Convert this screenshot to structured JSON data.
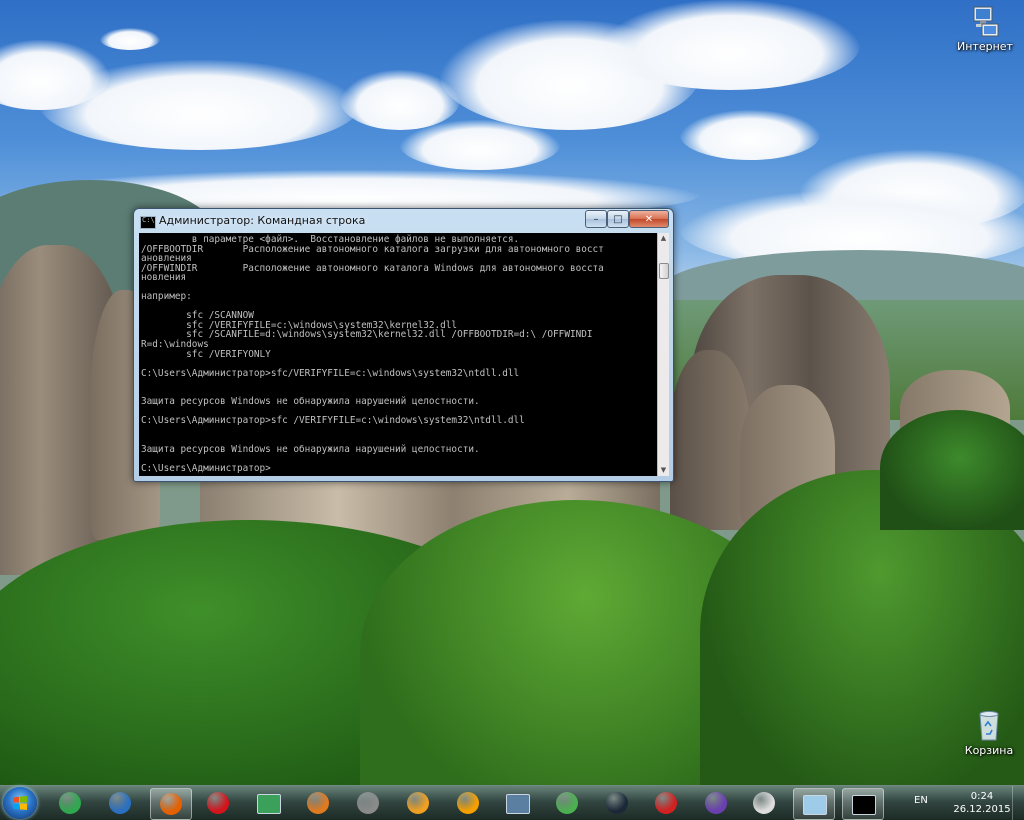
{
  "desktop": {
    "icons": [
      {
        "label": "Интернет",
        "icon": "network-computer-icon"
      },
      {
        "label": "Корзина",
        "icon": "recycle-bin-icon"
      }
    ]
  },
  "window": {
    "title": "Администратор: Командная строка",
    "icon_text": "C:\\",
    "buttons": {
      "minimize": "–",
      "maximize": "□",
      "close": "✕"
    },
    "console_lines": [
      "         в параметре <файл>.  Восстановление файлов не выполняется.",
      "/OFFBOOTDIR       Расположение автономного каталога загрузки для автономного восст",
      "ановления",
      "/OFFWINDIR        Расположение автономного каталога Windows для автономного восста",
      "новления",
      "",
      "например:",
      "",
      "        sfc /SCANNOW",
      "        sfc /VERIFYFILE=c:\\windows\\system32\\kernel32.dll",
      "        sfc /SCANFILE=d:\\windows\\system32\\kernel32.dll /OFFBOOTDIR=d:\\ /OFFWINDI",
      "R=d:\\windows",
      "        sfc /VERIFYONLY",
      "",
      "C:\\Users\\Администратор>sfc/VERIFYFILE=c:\\windows\\system32\\ntdll.dll",
      "",
      "",
      "Защита ресурсов Windows не обнаружила нарушений целостности.",
      "",
      "C:\\Users\\Администратор>sfc /VERIFYFILE=c:\\windows\\system32\\ntdll.dll",
      "",
      "",
      "Защита ресурсов Windows не обнаружила нарушений целостности.",
      "",
      "C:\\Users\\Администратор>"
    ]
  },
  "taskbar": {
    "apps": [
      {
        "name": "mail-ru-agent",
        "icon": "mail-at-icon",
        "color": "#2fa84f"
      },
      {
        "name": "browser-w",
        "icon": "w-browser-icon",
        "color": "#2a6fc0"
      },
      {
        "name": "firefox",
        "icon": "firefox-icon",
        "color": "#e66000",
        "active": true
      },
      {
        "name": "opera",
        "icon": "opera-icon",
        "color": "#d4141c"
      },
      {
        "name": "screen-app",
        "icon": "monitor-frame-icon",
        "color": "#3aa05a"
      },
      {
        "name": "eye-app",
        "icon": "eye-icon",
        "color": "#e07a20"
      },
      {
        "name": "disk-tool",
        "icon": "disk-tool-icon",
        "color": "#8a8a8a"
      },
      {
        "name": "swirl-app",
        "icon": "swirl-icon",
        "color": "#f0a020"
      },
      {
        "name": "aimp",
        "icon": "aimp-triangle-icon",
        "color": "#f5a000"
      },
      {
        "name": "monitor-app",
        "icon": "monitor-icon",
        "color": "#5a7fa0"
      },
      {
        "name": "mp3-app",
        "icon": "mp3-icon",
        "color": "#4caf50"
      },
      {
        "name": "steam",
        "icon": "steam-icon",
        "color": "#1b2838"
      },
      {
        "name": "apple-app",
        "icon": "apple-icon",
        "color": "#d32020"
      },
      {
        "name": "writer-app",
        "icon": "pen-book-icon",
        "color": "#6a3fb0"
      },
      {
        "name": "chess-app",
        "icon": "chess-piece-icon",
        "color": "#dddddd"
      },
      {
        "name": "explorer-window",
        "icon": "window-icon",
        "color": "#9ecbe8",
        "active": true
      },
      {
        "name": "cmd-window",
        "icon": "cmd-icon",
        "color": "#000000",
        "active": true
      }
    ],
    "language": "EN",
    "time": "0:24",
    "date": "26.12.2015"
  }
}
